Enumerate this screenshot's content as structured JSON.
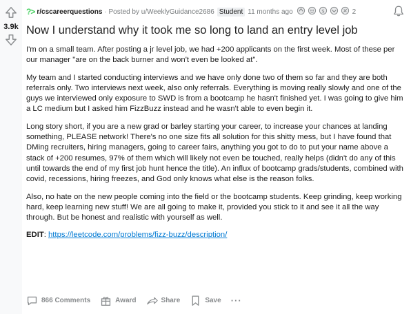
{
  "vote": {
    "count": "3.9k",
    "up_icon": "upvote-arrow-icon",
    "down_icon": "downvote-arrow-icon"
  },
  "meta": {
    "subreddit_icon": "?>",
    "subreddit": "r/cscareerquestions",
    "posted_by": "· Posted by u/WeeklyGuidance2686",
    "flair": "Student",
    "time": "11 months ago",
    "award_count": "2",
    "bell_icon": "bell-icon"
  },
  "post": {
    "title": "Now I understand why it took me so long to land an entry level job",
    "paragraphs": [
      "I'm on a small team. After posting a jr level job, we had +200 applicants on the first week. Most of these per our manager \"are on the back burner and won't even be looked at\".",
      "My team and I started conducting interviews and we have only done two of them so far and they are both referrals only. Two interviews next week, also only referrals. Everything is moving really slowly and one of the guys we interviewed only exposure to SWD is from a bootcamp he hasn't finished yet. I was going to give him a LC medium but I asked him FizzBuzz instead and he wasn't able to even begin it.",
      "Long story short, if you are a new grad or barley starting your career, to increase your chances at landing something, PLEASE network! There's no one size fits all solution for this shitty mess, but I have found that DMing recruiters, hiring managers, going to career fairs, anything you got to do to put your name above a stack of +200 resumes, 97% of them which will likely not even be touched, really helps (didn't do any of this until towards the end of my first job hunt hence the title). An influx of bootcamp grads/students, combined with covid, recessions, hiring freezes, and God only knows what else is the reason folks.",
      "Also, no hate on the new people coming into the field or the bootcamp students. Keep grinding, keep working hard, keep learning new stuff! We are all going to make it, provided you stick to it and see it all the way through. But be honest and realistic with yourself as well."
    ],
    "edit_label": "EDIT",
    "edit_sep": ": ",
    "edit_link": "https://leetcode.com/problems/fizz-buzz/description/"
  },
  "actions": {
    "comments": "866 Comments",
    "award": "Award",
    "share": "Share",
    "save": "Save",
    "more": "···"
  }
}
